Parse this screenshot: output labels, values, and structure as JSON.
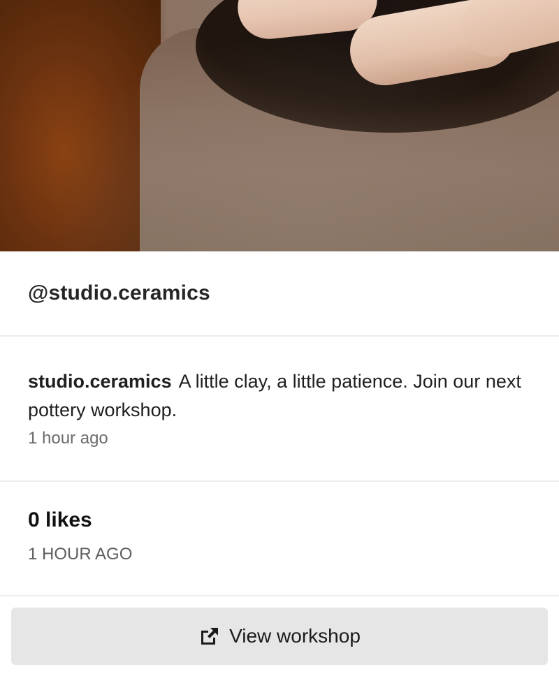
{
  "post": {
    "handle": "@studio.ceramics",
    "caption": {
      "username": "studio.ceramics",
      "text": "A little clay, a little patience. Join our next pottery workshop.",
      "time": "1 hour ago"
    },
    "likes": "0 likes",
    "timestamp": "1 HOUR AGO",
    "cta": {
      "label": "View workshop",
      "icon": "external-link-icon"
    }
  }
}
